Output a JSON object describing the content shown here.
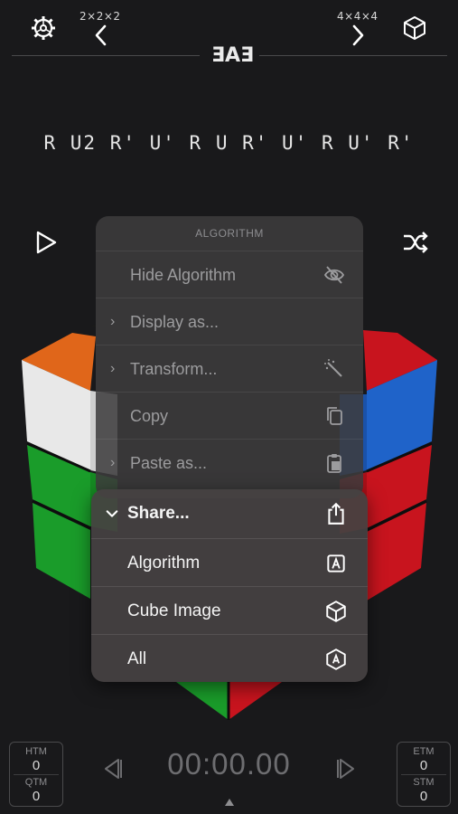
{
  "header": {
    "prev_puzzle": "2×2×2",
    "next_puzzle": "4×4×4",
    "logo": "ƎAƎ"
  },
  "algorithm": "R U2 R' U' R U R' U' R U' R'",
  "menu": {
    "title": "ALGORITHM",
    "items": [
      {
        "label": "Hide Algorithm",
        "icon": "eye-slash-icon"
      },
      {
        "label": "Display as...",
        "icon": "chevron-right-icon"
      },
      {
        "label": "Transform...",
        "icon": "magic-wand-icon"
      },
      {
        "label": "Copy",
        "icon": "copy-icon"
      },
      {
        "label": "Paste as...",
        "icon": "paste-icon"
      }
    ]
  },
  "share_menu": {
    "title": "Share...",
    "items": [
      {
        "label": "Algorithm",
        "icon": "letter-a-box-icon"
      },
      {
        "label": "Cube Image",
        "icon": "cube-icon"
      },
      {
        "label": "All",
        "icon": "cube-a-icon"
      }
    ]
  },
  "stats": {
    "htm_label": "HTM",
    "htm_value": "0",
    "qtm_label": "QTM",
    "qtm_value": "0",
    "etm_label": "ETM",
    "etm_value": "0",
    "stm_label": "STM",
    "stm_value": "0"
  },
  "timer": "00:00.00",
  "colors": {
    "background": "#19191b",
    "cube_red": "#c8141e",
    "cube_green": "#1a9c2a",
    "cube_blue": "#1f63c9",
    "cube_orange": "#e0661a",
    "cube_white": "#e8e8e8"
  }
}
